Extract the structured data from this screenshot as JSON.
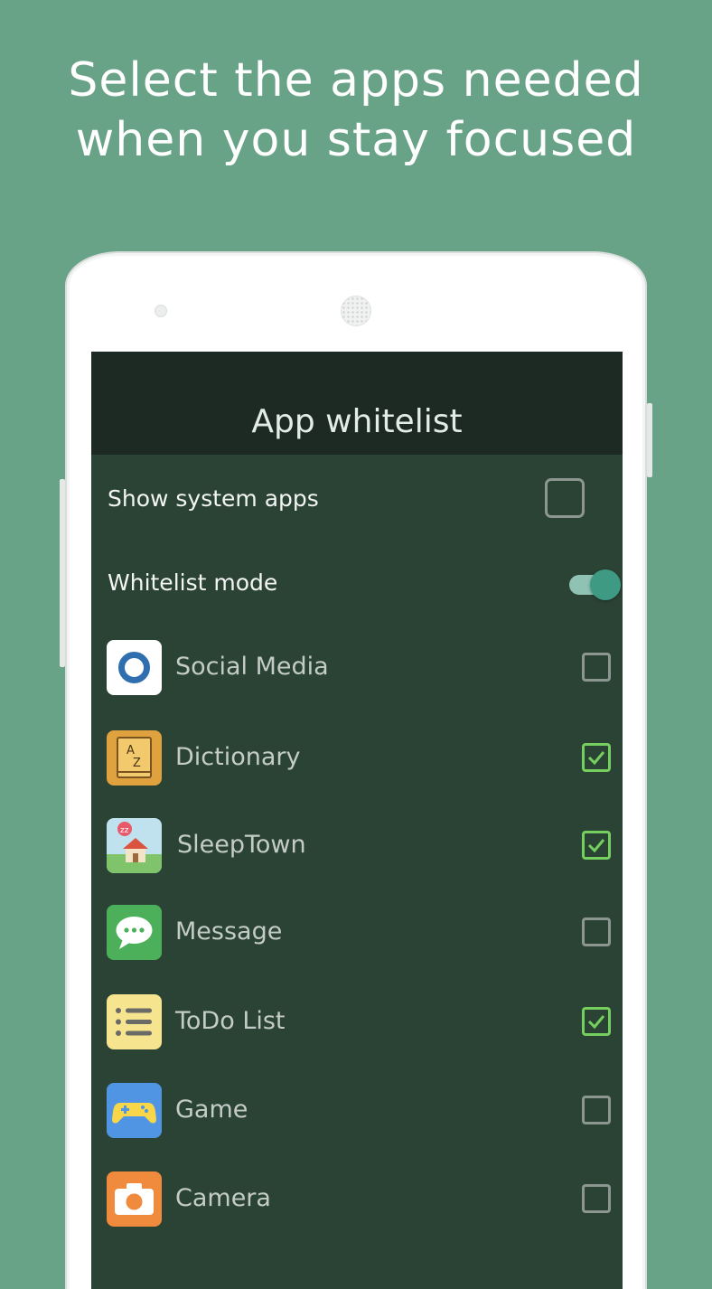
{
  "headline": {
    "line1": "Select the apps needed",
    "line2": "when you stay focused"
  },
  "appbar": {
    "title": "App whitelist"
  },
  "settings": {
    "show_system_apps": {
      "label": "Show system apps",
      "checked": false
    },
    "whitelist_mode": {
      "label": "Whitelist mode",
      "enabled": true
    }
  },
  "apps": [
    {
      "name": "Social Media",
      "checked": false,
      "icon": "social-media-icon"
    },
    {
      "name": "Dictionary",
      "checked": true,
      "icon": "dictionary-icon"
    },
    {
      "name": "SleepTown",
      "checked": true,
      "icon": "sleeptown-icon"
    },
    {
      "name": "Message",
      "checked": false,
      "icon": "message-icon"
    },
    {
      "name": "ToDo List",
      "checked": true,
      "icon": "todo-list-icon"
    },
    {
      "name": "Game",
      "checked": false,
      "icon": "game-controller-icon"
    },
    {
      "name": "Camera",
      "checked": false,
      "icon": "camera-icon"
    }
  ],
  "colors": {
    "background": "#68a287",
    "screen": "#2b4335",
    "appbar": "#1c2a23",
    "check_on": "#74cf5e",
    "toggle_thumb": "#3e9a83"
  }
}
